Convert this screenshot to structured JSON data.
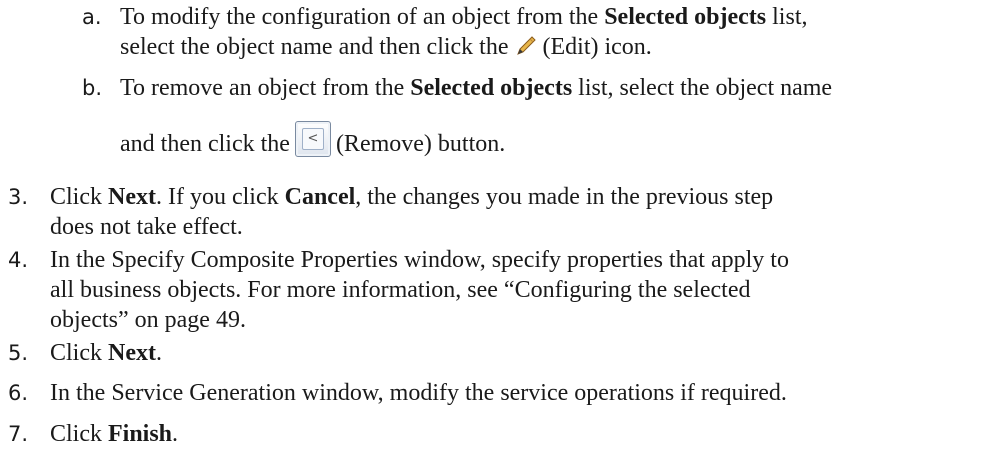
{
  "steps": {
    "a": {
      "marker": "a.",
      "l1_pre": "To modify the configuration of an object from the ",
      "l1_bold": "Selected objects",
      "l1_post": " list,",
      "l2_pre": "select the object name and then click the",
      "l2_post": "(Edit) icon.",
      "icon": "pencil-edit-icon"
    },
    "b": {
      "marker": "b.",
      "l1_pre": "To remove an object from the ",
      "l1_bold": "Selected objects",
      "l1_post": " list, select the object name",
      "l2_pre": "and then click the",
      "l2_post": "(Remove) button.",
      "button_glyph": "<"
    },
    "s3": {
      "marker": "3.",
      "pre": "Click ",
      "bold1": "Next",
      "mid": ". If you click ",
      "bold2": "Cancel",
      "post": ", the changes you made in the previous step",
      "line2": "does not take effect."
    },
    "s4": {
      "marker": "4.",
      "line1": "In the Specify Composite Properties window, specify properties that apply to",
      "line2": "all business objects. For more information, see “Configuring the selected",
      "line3": "objects” on page 49."
    },
    "s5": {
      "marker": "5.",
      "pre": "Click ",
      "bold": "Next",
      "post": "."
    },
    "s6": {
      "marker": "6.",
      "text": "In the Service Generation window, modify the service operations if required."
    },
    "s7": {
      "marker": "7.",
      "pre": "Click ",
      "bold": "Finish",
      "post": "."
    }
  }
}
